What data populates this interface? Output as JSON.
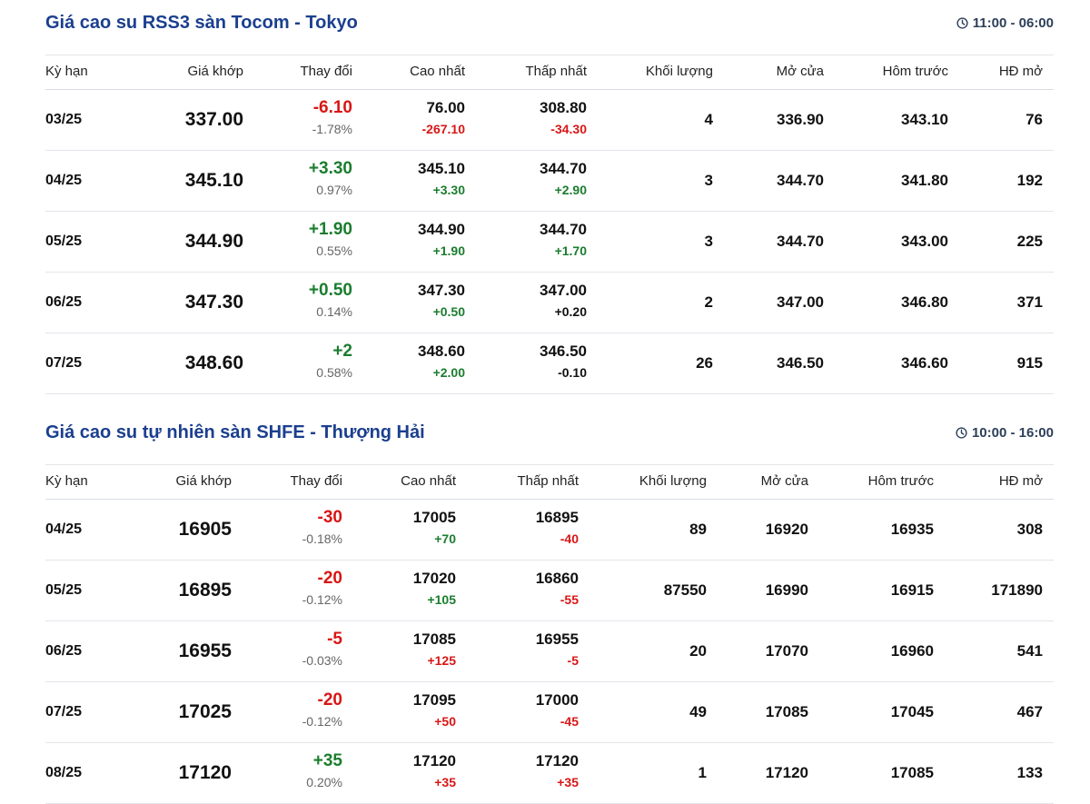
{
  "tokyo": {
    "title": "Giá cao su RSS3 sàn Tocom - Tokyo",
    "time": "11:00 - 06:00",
    "headers": {
      "ky_han": "Kỳ hạn",
      "gia_khop": "Giá khớp",
      "thay_doi": "Thay đổi",
      "cao_nhat": "Cao nhất",
      "thap_nhat": "Thấp nhất",
      "khoi_luong": "Khối lượng",
      "mo_cua": "Mở cửa",
      "hom_truoc": "Hôm trước",
      "hd_mo": "HĐ mở"
    },
    "rows": [
      {
        "ky_han": "03/25",
        "gia_khop": "337.00",
        "thay_doi": "-6.10",
        "thay_doi_dir": "neg",
        "thay_doi_pct": "-1.78%",
        "cao_nhat": "76.00",
        "cao_nhat_chg": "-267.10",
        "cao_nhat_dir": "neg",
        "thap_nhat": "308.80",
        "thap_nhat_chg": "-34.30",
        "thap_nhat_dir": "neg",
        "khoi_luong": "4",
        "mo_cua": "336.90",
        "hom_truoc": "343.10",
        "hd_mo": "76"
      },
      {
        "ky_han": "04/25",
        "gia_khop": "345.10",
        "thay_doi": "+3.30",
        "thay_doi_dir": "pos",
        "thay_doi_pct": "0.97%",
        "cao_nhat": "345.10",
        "cao_nhat_chg": "+3.30",
        "cao_nhat_dir": "pos",
        "thap_nhat": "344.70",
        "thap_nhat_chg": "+2.90",
        "thap_nhat_dir": "pos",
        "khoi_luong": "3",
        "mo_cua": "344.70",
        "hom_truoc": "341.80",
        "hd_mo": "192"
      },
      {
        "ky_han": "05/25",
        "gia_khop": "344.90",
        "thay_doi": "+1.90",
        "thay_doi_dir": "pos",
        "thay_doi_pct": "0.55%",
        "cao_nhat": "344.90",
        "cao_nhat_chg": "+1.90",
        "cao_nhat_dir": "pos",
        "thap_nhat": "344.70",
        "thap_nhat_chg": "+1.70",
        "thap_nhat_dir": "pos",
        "khoi_luong": "3",
        "mo_cua": "344.70",
        "hom_truoc": "343.00",
        "hd_mo": "225"
      },
      {
        "ky_han": "06/25",
        "gia_khop": "347.30",
        "thay_doi": "+0.50",
        "thay_doi_dir": "pos",
        "thay_doi_pct": "0.14%",
        "cao_nhat": "347.30",
        "cao_nhat_chg": "+0.50",
        "cao_nhat_dir": "pos",
        "thap_nhat": "347.00",
        "thap_nhat_chg": "+0.20",
        "thap_nhat_dir": "neu",
        "khoi_luong": "2",
        "mo_cua": "347.00",
        "hom_truoc": "346.80",
        "hd_mo": "371"
      },
      {
        "ky_han": "07/25",
        "gia_khop": "348.60",
        "thay_doi": "+2",
        "thay_doi_dir": "pos",
        "thay_doi_pct": "0.58%",
        "cao_nhat": "348.60",
        "cao_nhat_chg": "+2.00",
        "cao_nhat_dir": "pos",
        "thap_nhat": "346.50",
        "thap_nhat_chg": "-0.10",
        "thap_nhat_dir": "neu",
        "khoi_luong": "26",
        "mo_cua": "346.50",
        "hom_truoc": "346.60",
        "hd_mo": "915"
      }
    ]
  },
  "shfe": {
    "title": "Giá cao su tự nhiên sàn SHFE - Thượng Hải",
    "time": "10:00 - 16:00",
    "headers": {
      "ky_han": "Kỳ hạn",
      "gia_khop": "Giá khớp",
      "thay_doi": "Thay đổi",
      "cao_nhat": "Cao nhất",
      "thap_nhat": "Thấp nhất",
      "khoi_luong": "Khối lượng",
      "mo_cua": "Mở cửa",
      "hom_truoc": "Hôm trước",
      "hd_mo": "HĐ mở"
    },
    "rows": [
      {
        "ky_han": "04/25",
        "gia_khop": "16905",
        "thay_doi": "-30",
        "thay_doi_dir": "neg",
        "thay_doi_pct": "-0.18%",
        "cao_nhat": "17005",
        "cao_nhat_chg": "+70",
        "cao_nhat_dir": "pos",
        "thap_nhat": "16895",
        "thap_nhat_chg": "-40",
        "thap_nhat_dir": "neg",
        "khoi_luong": "89",
        "mo_cua": "16920",
        "hom_truoc": "16935",
        "hd_mo": "308"
      },
      {
        "ky_han": "05/25",
        "gia_khop": "16895",
        "thay_doi": "-20",
        "thay_doi_dir": "neg",
        "thay_doi_pct": "-0.12%",
        "cao_nhat": "17020",
        "cao_nhat_chg": "+105",
        "cao_nhat_dir": "pos",
        "thap_nhat": "16860",
        "thap_nhat_chg": "-55",
        "thap_nhat_dir": "neg",
        "khoi_luong": "87550",
        "mo_cua": "16990",
        "hom_truoc": "16915",
        "hd_mo": "171890"
      },
      {
        "ky_han": "06/25",
        "gia_khop": "16955",
        "thay_doi": "-5",
        "thay_doi_dir": "neg",
        "thay_doi_pct": "-0.03%",
        "cao_nhat": "17085",
        "cao_nhat_chg": "+125",
        "cao_nhat_dir": "neg",
        "thap_nhat": "16955",
        "thap_nhat_chg": "-5",
        "thap_nhat_dir": "neg",
        "khoi_luong": "20",
        "mo_cua": "17070",
        "hom_truoc": "16960",
        "hd_mo": "541"
      },
      {
        "ky_han": "07/25",
        "gia_khop": "17025",
        "thay_doi": "-20",
        "thay_doi_dir": "neg",
        "thay_doi_pct": "-0.12%",
        "cao_nhat": "17095",
        "cao_nhat_chg": "+50",
        "cao_nhat_dir": "neg",
        "thap_nhat": "17000",
        "thap_nhat_chg": "-45",
        "thap_nhat_dir": "neg",
        "khoi_luong": "49",
        "mo_cua": "17085",
        "hom_truoc": "17045",
        "hd_mo": "467"
      },
      {
        "ky_han": "08/25",
        "gia_khop": "17120",
        "thay_doi": "+35",
        "thay_doi_dir": "pos",
        "thay_doi_pct": "0.20%",
        "cao_nhat": "17120",
        "cao_nhat_chg": "+35",
        "cao_nhat_dir": "neg",
        "thap_nhat": "17120",
        "thap_nhat_chg": "+35",
        "thap_nhat_dir": "neg",
        "khoi_luong": "1",
        "mo_cua": "17120",
        "hom_truoc": "17085",
        "hd_mo": "133"
      }
    ]
  }
}
